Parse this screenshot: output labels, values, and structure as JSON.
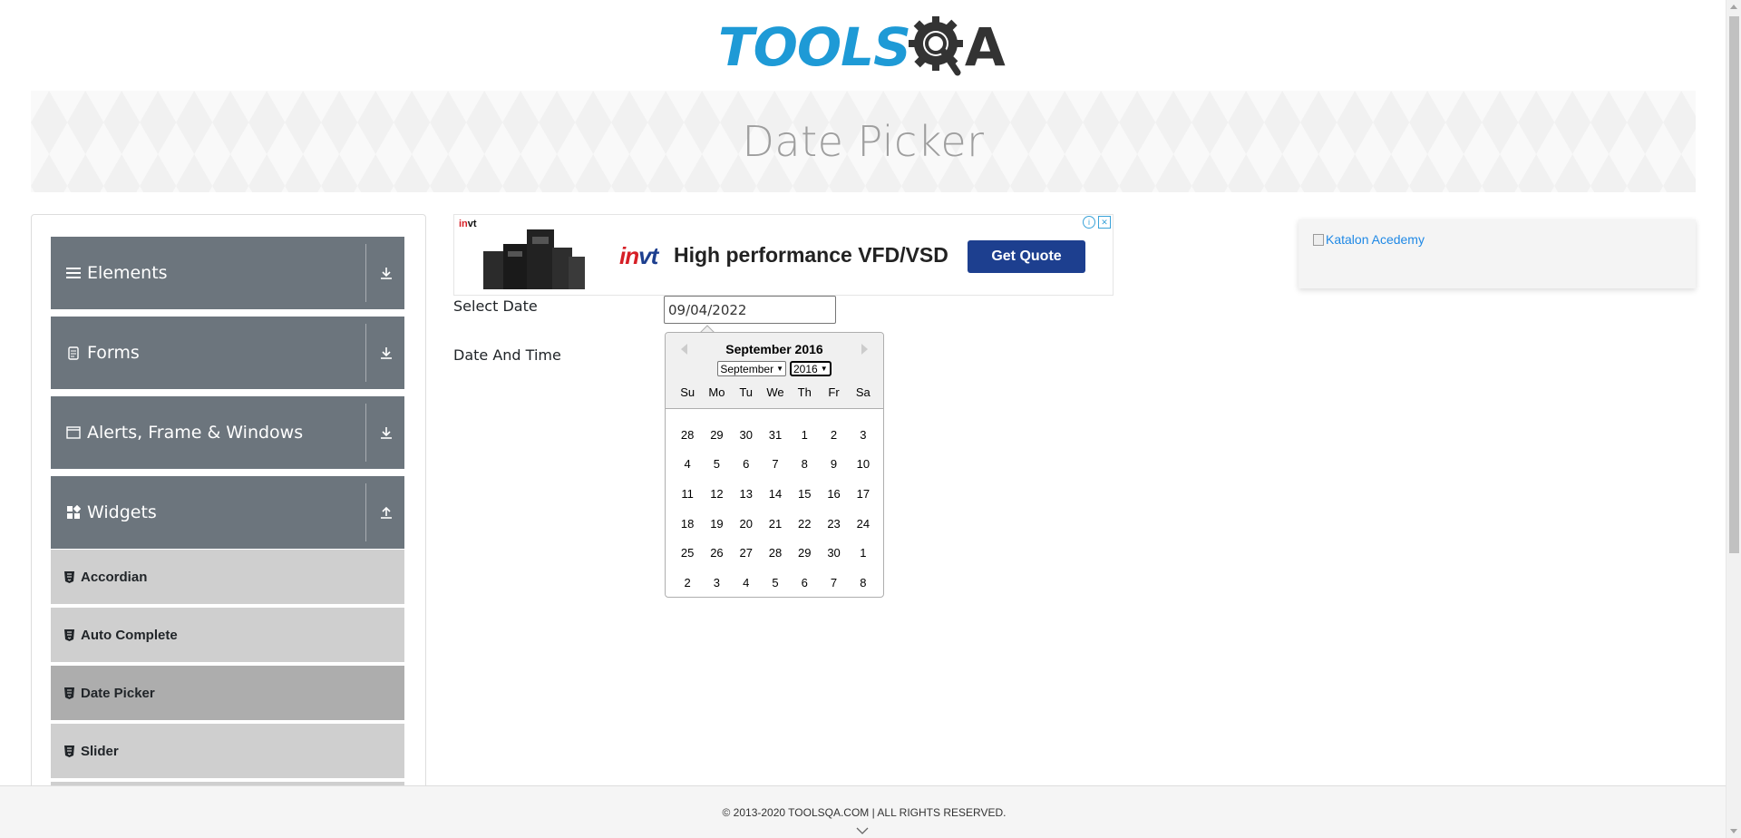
{
  "header": {
    "logo_text": "TOOLS",
    "logo_tail": "A",
    "brand_color": "#1e9ad6"
  },
  "banner": {
    "title": "Date Picker"
  },
  "sidebar": {
    "groups": [
      {
        "label": "Elements",
        "icon": "list-icon",
        "arrow": "download-arrow-icon"
      },
      {
        "label": "Forms",
        "icon": "document-icon",
        "arrow": "download-arrow-icon"
      },
      {
        "label": "Alerts, Frame & Windows",
        "icon": "window-icon",
        "arrow": "download-arrow-icon"
      },
      {
        "label": "Widgets",
        "icon": "grid-icon",
        "arrow": "upload-arrow-icon"
      }
    ],
    "items": [
      {
        "label": "Accordian",
        "icon": "html5-icon",
        "active": false
      },
      {
        "label": "Auto Complete",
        "icon": "html5-icon",
        "active": false
      },
      {
        "label": "Date Picker",
        "icon": "html5-icon",
        "active": true
      },
      {
        "label": "Slider",
        "icon": "html5-icon",
        "active": false
      }
    ],
    "header_color": "#6c757d"
  },
  "ad": {
    "small_brand_a": "in",
    "small_brand_b": "vt",
    "logo_a": "in",
    "logo_b": "vt",
    "headline": "High performance VFD/VSD",
    "cta": "Get Quote",
    "info_glyph": "i",
    "close_glyph": "✕",
    "accent_color": "#1d3f8f"
  },
  "right_ad": {
    "alt_text": "Katalon Acedemy"
  },
  "form": {
    "select_date_label": "Select Date",
    "date_time_label": "Date And Time",
    "date_value": "09/04/2022"
  },
  "calendar": {
    "current_month": "September 2016",
    "month_select": "September",
    "year_select": "2016",
    "weekdays": [
      "Su",
      "Mo",
      "Tu",
      "We",
      "Th",
      "Fr",
      "Sa"
    ],
    "weeks": [
      [
        "28",
        "29",
        "30",
        "31",
        "1",
        "2",
        "3"
      ],
      [
        "4",
        "5",
        "6",
        "7",
        "8",
        "9",
        "10"
      ],
      [
        "11",
        "12",
        "13",
        "14",
        "15",
        "16",
        "17"
      ],
      [
        "18",
        "19",
        "20",
        "21",
        "22",
        "23",
        "24"
      ],
      [
        "25",
        "26",
        "27",
        "28",
        "29",
        "30",
        "1"
      ],
      [
        "2",
        "3",
        "4",
        "5",
        "6",
        "7",
        "8"
      ]
    ]
  },
  "footer": {
    "text": "© 2013-2020 TOOLSQA.COM | ALL RIGHTS RESERVED."
  }
}
